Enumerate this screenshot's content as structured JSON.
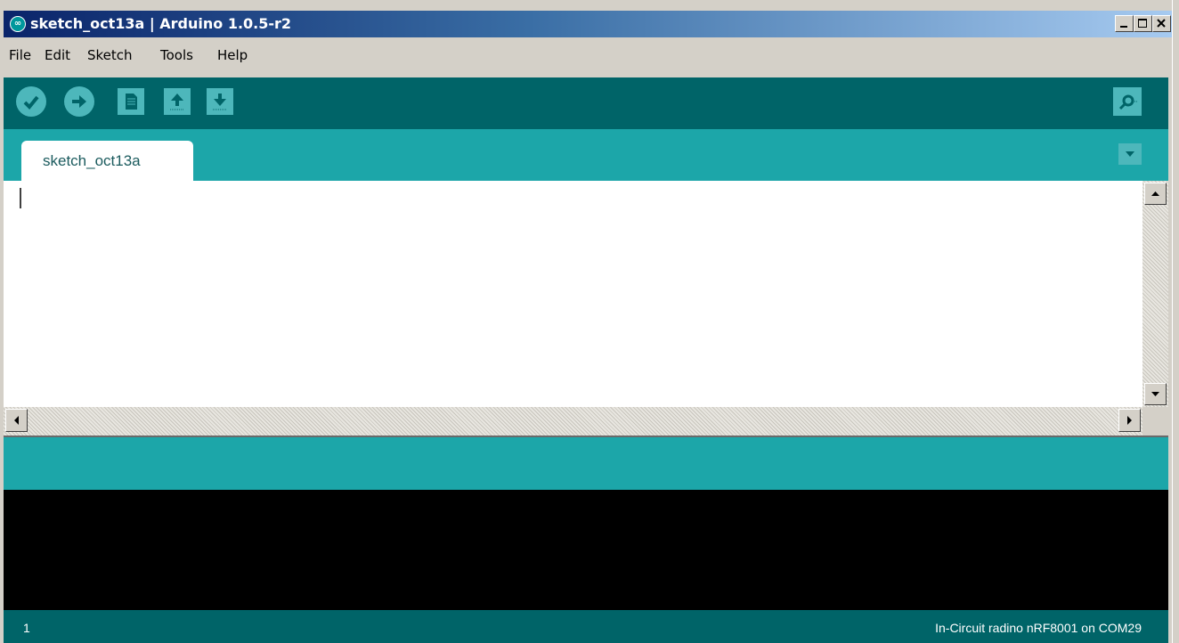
{
  "window": {
    "title": "sketch_oct13a | Arduino 1.0.5-r2",
    "icon": "arduino-logo-icon",
    "controls": [
      "minimize-icon",
      "maximize-icon",
      "close-icon"
    ]
  },
  "menu": [
    {
      "label": "File"
    },
    {
      "label": "Edit"
    },
    {
      "label": "Sketch"
    },
    {
      "label": "Tools"
    },
    {
      "label": "Help"
    }
  ],
  "toolbar": {
    "buttons": [
      {
        "name": "verify",
        "icon": "check-icon"
      },
      {
        "name": "upload",
        "icon": "arrow-right-icon"
      },
      {
        "name": "new",
        "icon": "document-icon"
      },
      {
        "name": "open",
        "icon": "arrow-up-icon"
      },
      {
        "name": "save",
        "icon": "arrow-down-icon"
      }
    ],
    "serial_monitor_icon": "magnifier-icon"
  },
  "tabs": [
    {
      "label": "sketch_oct13a",
      "selected": true
    }
  ],
  "editor": {
    "content": ""
  },
  "status_message": "",
  "console_output": "",
  "footer": {
    "line_number": "1",
    "board_port": "In-Circuit radino nRF8001 on COM29"
  },
  "colors": {
    "toolbar": "#006468",
    "tab_strip": "#1ca6a9",
    "button": "#4db7bb",
    "console": "#000000",
    "title_gradient_start": "#0a246a",
    "title_gradient_end": "#a6caf0"
  }
}
